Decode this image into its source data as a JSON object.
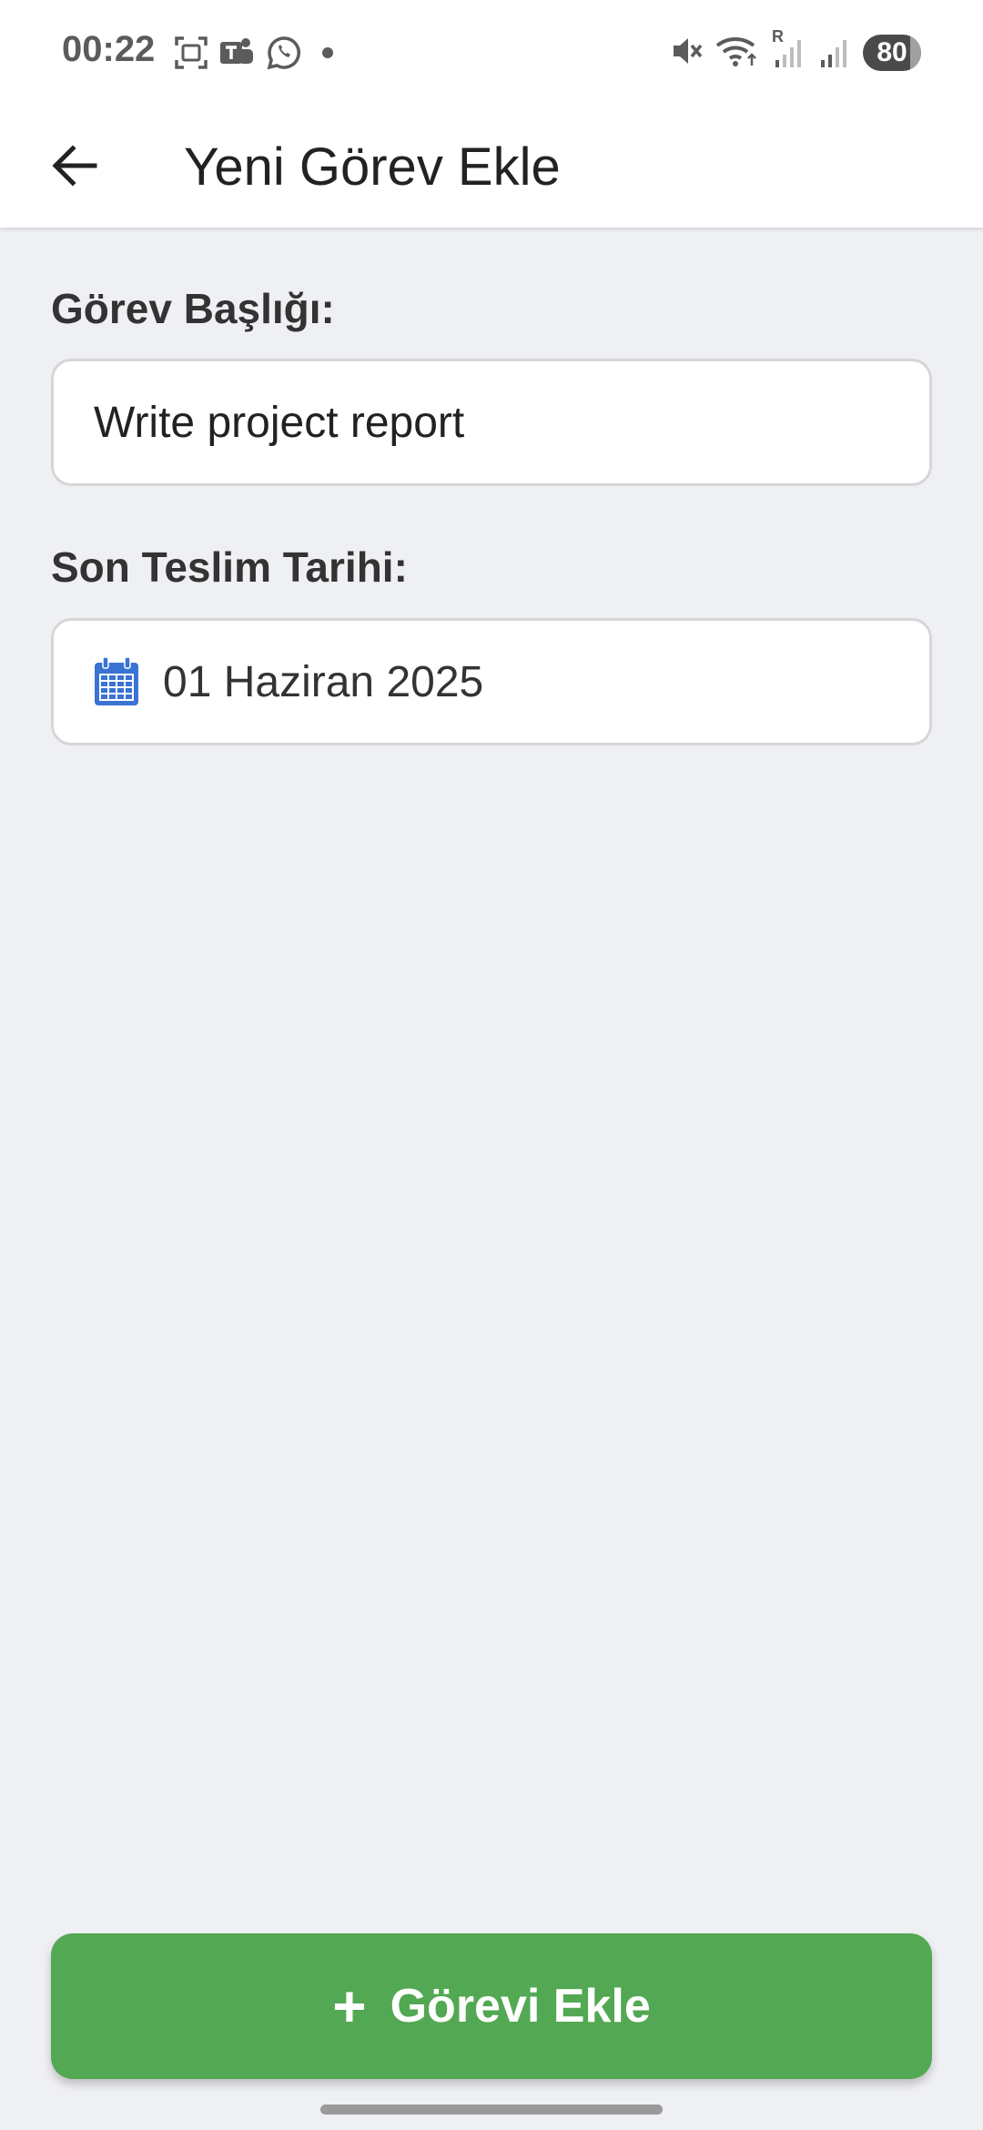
{
  "status_bar": {
    "time": "00:22",
    "left_icons": [
      "screenshot-icon",
      "teams-icon",
      "whatsapp-icon",
      "dot-icon"
    ],
    "right_icons": [
      "mute-icon",
      "wifi-icon",
      "signal-roaming-icon",
      "signal-icon"
    ],
    "roaming_label": "R",
    "battery": "80"
  },
  "header": {
    "title": "Yeni Görev Ekle",
    "back_icon": "arrow-left-icon"
  },
  "form": {
    "title_label": "Görev Başlığı:",
    "title_value": "Write project report",
    "date_label": "Son Teslim Tarihi:",
    "date_value": "01 Haziran 2025",
    "date_icon": "calendar-icon"
  },
  "actions": {
    "add_plus": "+",
    "add_label": "Görevi Ekle"
  },
  "colors": {
    "primary_button": "#53a853",
    "calendar_icon": "#3b73d4",
    "background": "#eff0f4"
  }
}
